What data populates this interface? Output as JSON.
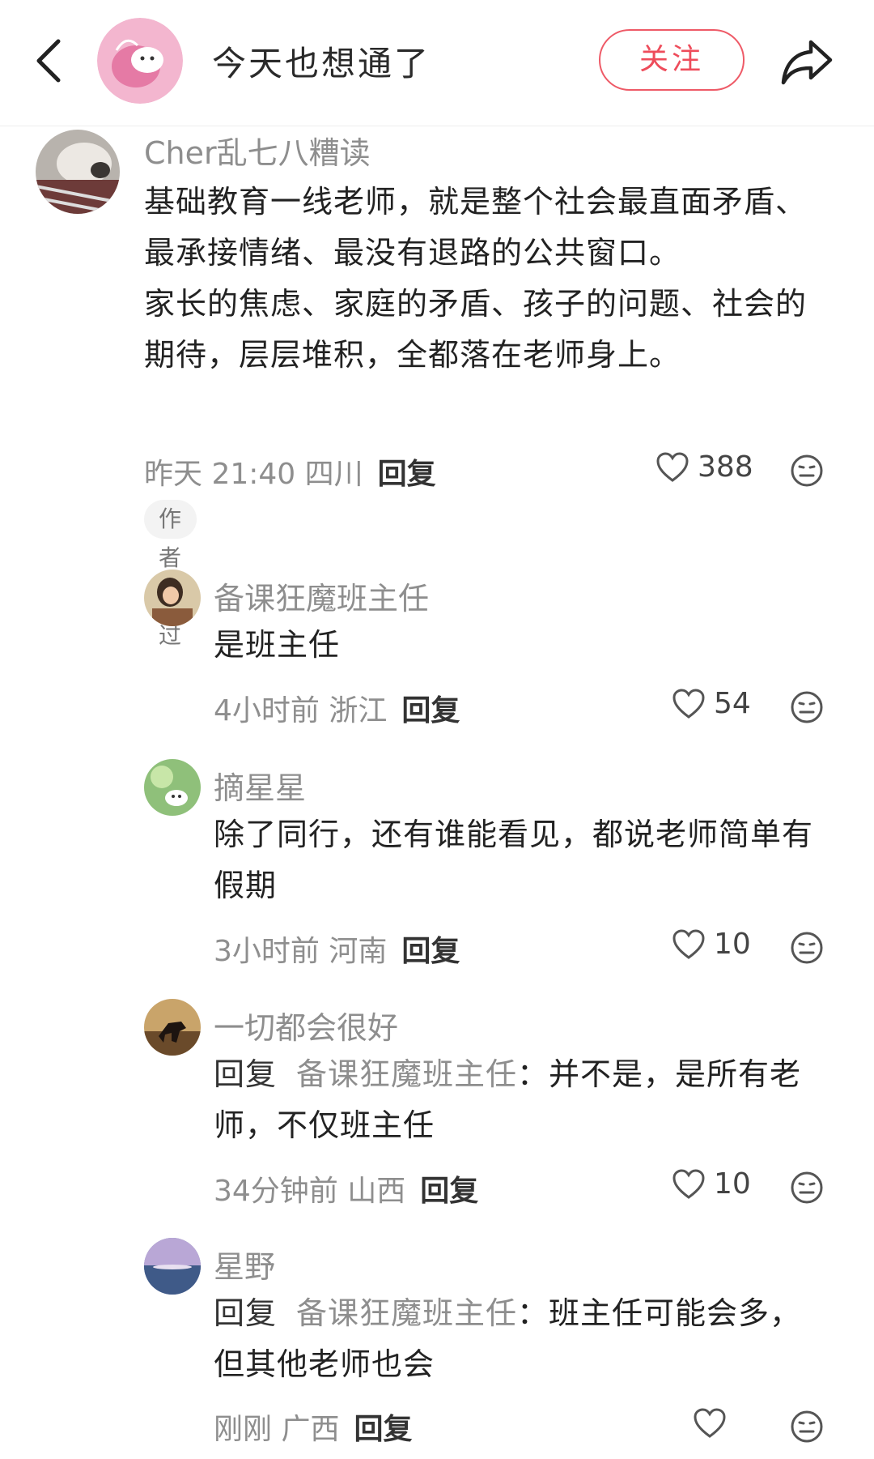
{
  "header": {
    "title": "今天也想通了",
    "follow_label": "关注"
  },
  "comments": [
    {
      "name": "Cher乱七八糟读",
      "lines": [
        "基础教育一线老师，就是整个社会最直面矛盾、",
        "最承接情绪、最没有退路的公共窗口。",
        "家长的焦虑、家庭的矛盾、孩子的问题、社会的",
        "期待，层层堆积，全都落在老师身上。"
      ],
      "time_location": "昨天 21:40 四川",
      "reply_label": "回复",
      "likes": "388",
      "badge": "作者赞过"
    }
  ],
  "replies": [
    {
      "name": "备课狂魔班主任",
      "lines": [
        "是班主任"
      ],
      "time_location": "4小时前 浙江",
      "reply_label": "回复",
      "likes": "54"
    },
    {
      "name": "摘星星",
      "lines": [
        "除了同行，还有谁能看见，都说老师简单有",
        "假期"
      ],
      "time_location": "3小时前 河南",
      "reply_label": "回复",
      "likes": "10"
    },
    {
      "name": "一切都会很好",
      "reply_prefix": "回复",
      "reply_target": "备课狂魔班主任",
      "line1_rest": "：并不是，是所有老",
      "line2": "师，不仅班主任",
      "time_location": "34分钟前 山西",
      "reply_label": "回复",
      "likes": "10"
    },
    {
      "name": "星野",
      "reply_prefix": "回复",
      "reply_target": "备课狂魔班主任",
      "line1_rest": "：班主任可能会多，",
      "line2": "但其他老师也会",
      "time_location": "刚刚 广西",
      "reply_label": "回复",
      "likes": ""
    }
  ],
  "colors": {
    "accent": "#ee4c5b",
    "secondary_text": "#8e8e8e"
  },
  "icons": [
    "back-icon",
    "share-icon",
    "heart-icon",
    "emoji-icon"
  ]
}
